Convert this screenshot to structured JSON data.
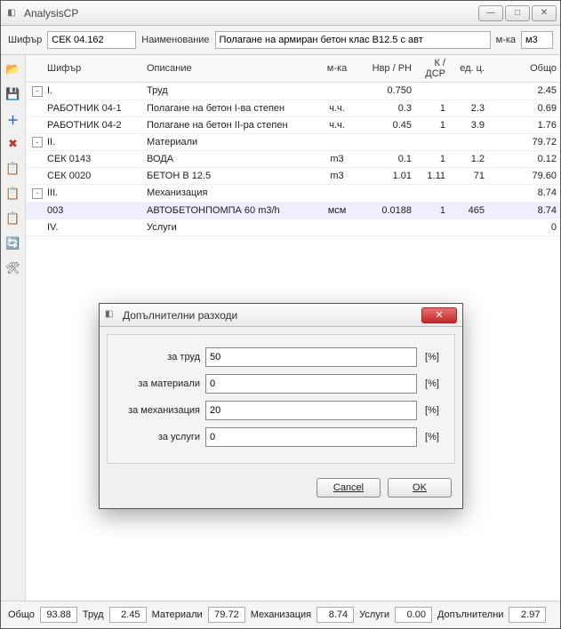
{
  "window": {
    "title": "AnalysisCP"
  },
  "header": {
    "code_label": "Шифър",
    "code_value": "СЕК 04.162",
    "name_label": "Наименование",
    "name_value": "Полагане на армиран бетон клас В12.5 с авт",
    "unit_label": "м-ка",
    "unit_value": "м3"
  },
  "columns": {
    "code": "Шифър",
    "desc": "Описание",
    "unit": "м-ка",
    "nvr": "Нвр / РН",
    "k": "К / ДСР",
    "price": "ед. ц.",
    "total": "Общо"
  },
  "rows": [
    {
      "exp": "-",
      "code": "I.",
      "desc": "Труд",
      "unit": "",
      "nvr": "0.750",
      "k": "",
      "price": "",
      "total": "2.45"
    },
    {
      "exp": "",
      "code": "РАБОТНИК 04-1",
      "desc": "Полагане на бетон I-ва степен",
      "unit": "ч.ч.",
      "nvr": "0.3",
      "k": "1",
      "price": "2.3",
      "total": "0.69"
    },
    {
      "exp": "",
      "code": "РАБОТНИК 04-2",
      "desc": "Полагане на бетон II-ра степен",
      "unit": "ч.ч.",
      "nvr": "0.45",
      "k": "1",
      "price": "3.9",
      "total": "1.76"
    },
    {
      "exp": "-",
      "code": "II.",
      "desc": "Материали",
      "unit": "",
      "nvr": "",
      "k": "",
      "price": "",
      "total": "79.72"
    },
    {
      "exp": "",
      "code": "СЕК 0143",
      "desc": "ВОДА",
      "unit": "m3",
      "nvr": "0.1",
      "k": "1",
      "price": "1.2",
      "total": "0.12"
    },
    {
      "exp": "",
      "code": "СЕК 0020",
      "desc": "БЕТОН В 12.5",
      "unit": "m3",
      "nvr": "1.01",
      "k": "1.11",
      "price": "71",
      "total": "79.60"
    },
    {
      "exp": "-",
      "code": "III.",
      "desc": "Механизация",
      "unit": "",
      "nvr": "",
      "k": "",
      "price": "",
      "total": "8.74"
    },
    {
      "exp": "",
      "code": "003",
      "desc": "АВТОБЕТОНПОМПА 60 m3/h",
      "unit": "мсм",
      "nvr": "0.0188",
      "k": "1",
      "price": "465",
      "total": "8.74",
      "selected": true
    },
    {
      "exp": "",
      "code": "IV.",
      "desc": "Услуги",
      "unit": "",
      "nvr": "",
      "k": "",
      "price": "",
      "total": "0"
    }
  ],
  "dialog": {
    "title": "Допълнителни разходи",
    "labels": {
      "labor": "за труд",
      "mat": "за материали",
      "mech": "за механизация",
      "svc": "за услуги"
    },
    "values": {
      "labor": "50",
      "mat": "0",
      "mech": "20",
      "svc": "0"
    },
    "pct": "[%]",
    "cancel": "Cancel",
    "ok": "OK"
  },
  "status": {
    "total_label": "Общо",
    "total": "93.88",
    "labor_label": "Труд",
    "labor": "2.45",
    "mat_label": "Материали",
    "mat": "79.72",
    "mech_label": "Механизация",
    "mech": "8.74",
    "svc_label": "Услуги",
    "svc": "0.00",
    "extra_label": "Допълнителни",
    "extra": "2.97"
  },
  "toolbar_icons": [
    "📂",
    "💾",
    "＋",
    "✖",
    "📋",
    "📋",
    "📋",
    "🔄",
    "🛠"
  ]
}
